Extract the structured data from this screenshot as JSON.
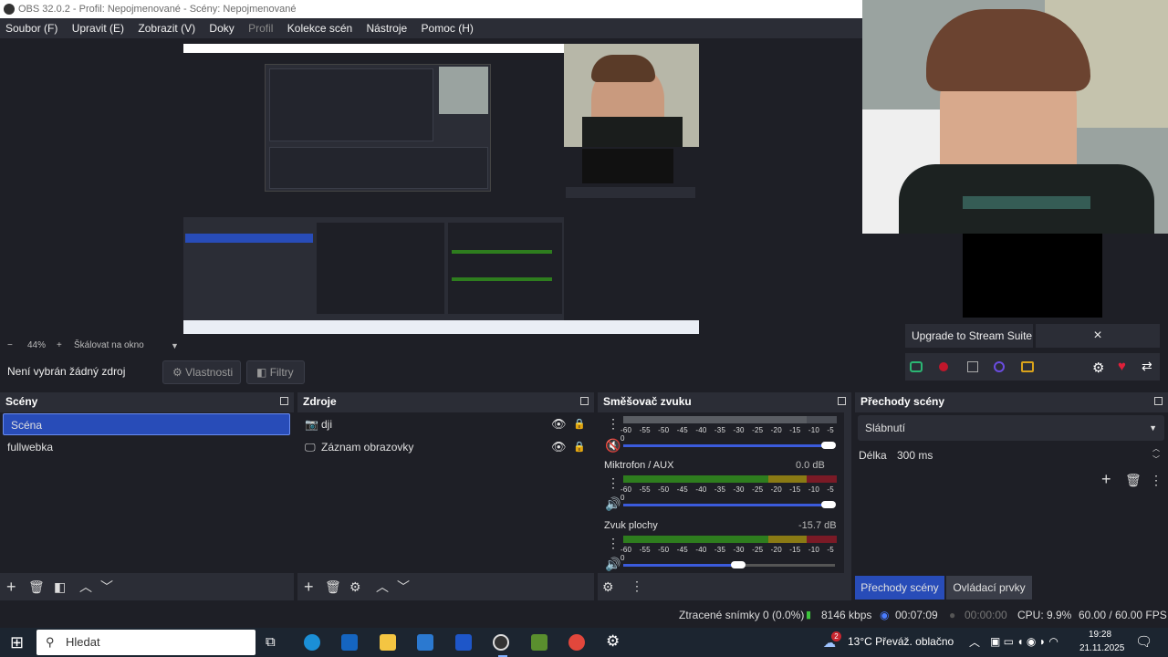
{
  "window": {
    "title": "OBS 32.0.2 - Profil: Nepojmenované - Scény: Nepojmenované"
  },
  "menu": [
    "Soubor (F)",
    "Upravit (E)",
    "Zobrazit (V)",
    "Doky",
    "Profil",
    "Kolekce scén",
    "Nástroje",
    "Pomoc (H)"
  ],
  "zoom": {
    "minus": "−",
    "value": "44%",
    "plus": "+",
    "mode": "Škálovat na okno"
  },
  "source_bar": {
    "no_source": "Není vybrán žádný zdroj",
    "properties": "Vlastnosti",
    "filters": "Filtry"
  },
  "cam_panel": {
    "upgrade": "Upgrade to Stream Suite",
    "close": "×"
  },
  "scenes": {
    "title": "Scény",
    "items": [
      "Scéna",
      "fullwebka"
    ]
  },
  "sources": {
    "title": "Zdroje",
    "items": [
      "dji",
      "Záznam obrazovky"
    ]
  },
  "mixer": {
    "title": "Směšovač zvuku",
    "scale": "-60 -55 -50 -45 -40 -35 -30 -25 -20 -15 -10 -5 0",
    "channels": [
      {
        "name": "",
        "db": ""
      },
      {
        "name": "Miktrofon / AUX",
        "db": "0.0 dB"
      },
      {
        "name": "Zvuk plochy",
        "db": "-15.7 dB"
      }
    ]
  },
  "transitions": {
    "title": "Přechody scény",
    "selected": "Slábnutí",
    "duration_label": "Délka",
    "duration": "300 ms"
  },
  "tabs": {
    "transitions": "Přechody scény",
    "controls": "Ovládací prvky"
  },
  "status": {
    "dropped": "Ztracené snímky 0 (0.0%)",
    "kbps": "8146 kbps",
    "stream_time": "00:07:09",
    "rec_time": "00:00:00",
    "cpu": "CPU: 9.9%",
    "fps": "60.00 / 60.00 FPS"
  },
  "taskbar": {
    "search": "Hledat",
    "weather_badge": "2",
    "weather": "13°C  Převáž. oblačno",
    "time": "19:28",
    "date": "21.11.2025"
  },
  "colors": {
    "accent": "#284cb8",
    "panel": "#2b2d36",
    "bg": "#1e1f26",
    "meter_green": "#2e7d1e",
    "meter_yellow": "#8a7a14",
    "meter_red": "#7a1a26"
  }
}
